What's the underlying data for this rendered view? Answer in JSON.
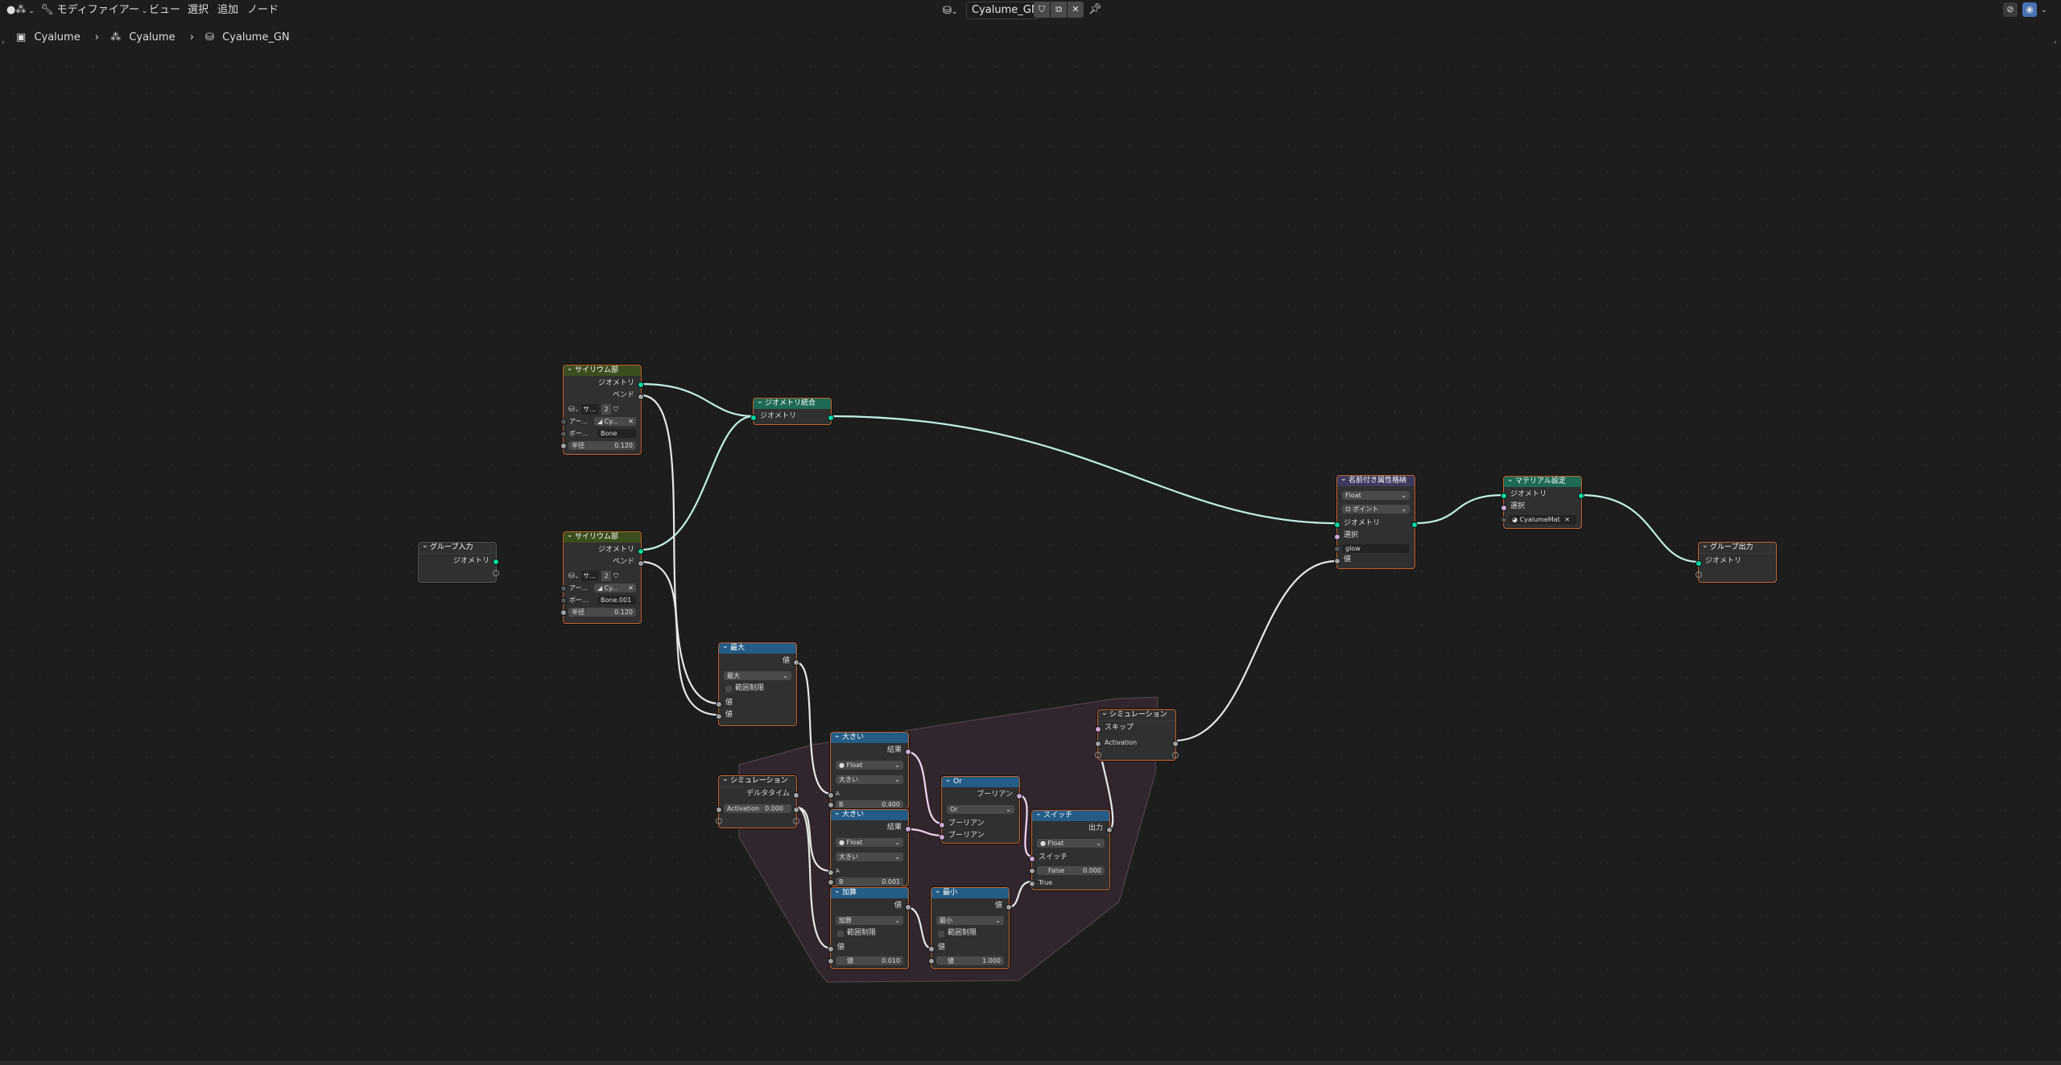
{
  "header": {
    "editor_menu": "モディファイアー",
    "menus": [
      "ビュー",
      "選択",
      "追加",
      "ノード"
    ],
    "tree_name": "Cyalume_GN"
  },
  "breadcrumb": [
    "Cyalume",
    "Cyalume",
    "Cyalume_GN"
  ],
  "nodes": {
    "group_input": {
      "title": "グループ入力",
      "out_geometry": "ジオメトリ"
    },
    "curve1": {
      "title": "サイリウム部",
      "out_geometry": "ジオメトリ",
      "out_bend": "ベンド",
      "rig_label": "サ...",
      "rig_num": "2",
      "armature_label": "アー...",
      "armature_value": "Cy...",
      "bone_label": "ボー...",
      "bone_value": "Bone",
      "radius_label": "半径",
      "radius_value": "0.120"
    },
    "curve2": {
      "title": "サイリウム部",
      "out_geometry": "ジオメトリ",
      "out_bend": "ベンド",
      "rig_label": "サ...",
      "rig_num": "2",
      "armature_label": "アー...",
      "armature_value": "Cy...",
      "bone_label": "ボー...",
      "bone_value": "Bone.001",
      "radius_label": "半径",
      "radius_value": "0.120"
    },
    "join": {
      "title": "ジオメトリ統合",
      "in_geometry": "ジオメトリ"
    },
    "named_attr": {
      "title": "名前付き属性格納",
      "type": "Float",
      "domain": "ポイント",
      "geometry": "ジオメトリ",
      "selection": "選択",
      "name": "glow",
      "value": "値"
    },
    "material": {
      "title": "マテリアル設定",
      "geometry": "ジオメトリ",
      "selection": "選択",
      "material": "CyalumeMat"
    },
    "group_output": {
      "title": "グループ出力",
      "geometry": "ジオメトリ"
    },
    "max": {
      "title": "最大",
      "out": "値",
      "op": "最大",
      "clamp": "範囲制限",
      "in1": "値",
      "in2": "値"
    },
    "sim_in": {
      "title": "シミュレーション",
      "delta": "デルタタイム",
      "activation_label": "Activation",
      "activation_value": "0.000"
    },
    "greater1": {
      "title": "大きい",
      "out": "結果",
      "type": "Float",
      "op": "大きい",
      "a": "A",
      "b_label": "B",
      "b_value": "0.400"
    },
    "greater2": {
      "title": "大きい",
      "out": "結果",
      "type": "Float",
      "op": "大きい",
      "a": "A",
      "b_label": "B",
      "b_value": "0.001"
    },
    "add": {
      "title": "加算",
      "out": "値",
      "op": "加算",
      "clamp": "範囲制限",
      "in1": "値",
      "in2_label": "値",
      "in2_value": "0.010"
    },
    "min": {
      "title": "最小",
      "out": "値",
      "op": "最小",
      "clamp": "範囲制限",
      "in1": "値",
      "in2_label": "値",
      "in2_value": "1.000"
    },
    "or": {
      "title": "Or",
      "out": "ブーリアン",
      "op": "Or",
      "in1": "ブーリアン",
      "in2": "ブーリアン"
    },
    "switch": {
      "title": "スイッチ",
      "out": "出力",
      "type": "Float",
      "switch": "スイッチ",
      "false_label": "False",
      "false_value": "0.000",
      "true_label": "True"
    },
    "sim_out": {
      "title": "シミュレーション",
      "skip": "スキップ",
      "activation": "Activation"
    }
  },
  "colors": {
    "geometry_socket": "#00d6a3",
    "float_socket": "#a1a1a1",
    "bool_socket": "#cca6d6",
    "node_selected_border": "#c8632a",
    "background": "#1d1d1d"
  }
}
